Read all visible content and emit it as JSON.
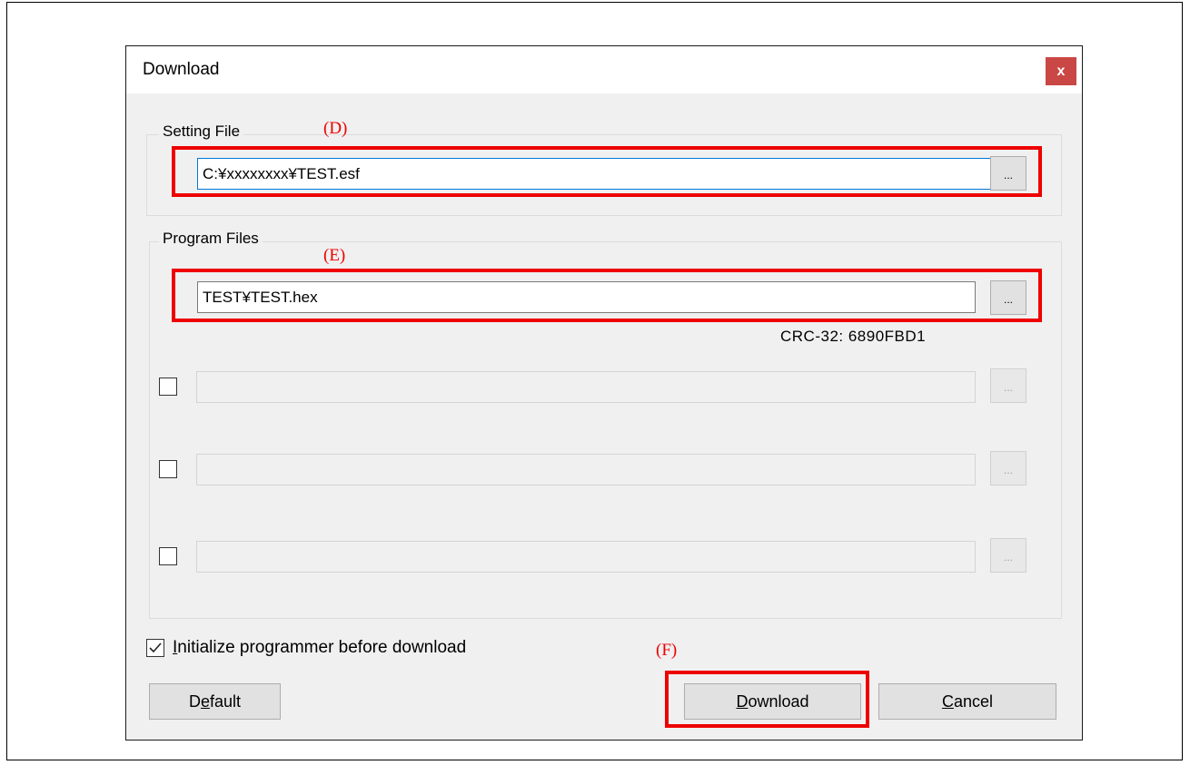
{
  "dialog": {
    "title": "Download",
    "close_label": "x"
  },
  "setting_file": {
    "group_label": "Setting File",
    "path_value": "C:¥xxxxxxxx¥TEST.esf",
    "browse_label": "..."
  },
  "program_files": {
    "group_label": "Program Files",
    "primary_path": "TEST¥TEST.hex",
    "browse_label": "...",
    "crc_text": "CRC-32: 6890FBD1",
    "additional": [
      {
        "checked": false,
        "value": "",
        "browse_label": "..."
      },
      {
        "checked": false,
        "value": "",
        "browse_label": "..."
      },
      {
        "checked": false,
        "value": "",
        "browse_label": "..."
      }
    ]
  },
  "options": {
    "initialize_checked": true,
    "initialize_first": "I",
    "initialize_rest": "nitialize programmer before download"
  },
  "buttons": {
    "default_first": "D",
    "default_mnemonic": "e",
    "default_rest": "fault",
    "download_mnemonic": "D",
    "download_rest": "ownload",
    "cancel_mnemonic": "C",
    "cancel_rest": "ancel"
  },
  "annotations": {
    "d": "(D)",
    "e": "(E)",
    "f": "(F)",
    "color": "#ee0000"
  }
}
